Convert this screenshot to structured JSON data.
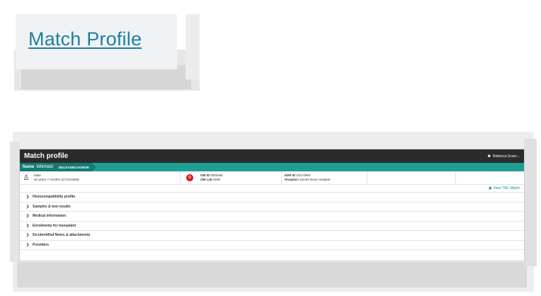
{
  "thumbnail": {
    "link_label": "Match Profile",
    "link_color": "#1e7fa6"
  },
  "app": {
    "title": "Match profile",
    "user_name": "Rebecca Scam...",
    "topbar_color": "#2b2b2b",
    "accent_color": "#1f9e94"
  },
  "donor": {
    "name_label": "Name",
    "name_value": "Withheld",
    "badge": "DECEASED DONOR",
    "sex": "Male",
    "age": "50 years 7 months (27/12/1965)",
    "blood_group": "O",
    "om_id_label": "OM ID",
    "om_id": "0092066",
    "om_lab_label": "OM Lab",
    "om_lab": "NSW",
    "edr_id_label": "EDR ID",
    "edr_id": "D22-0960",
    "hospital_label": "Hospital",
    "hospital": "Lismore Base Hospital"
  },
  "actions": {
    "view_twl_match": "View TWL Match"
  },
  "sections": [
    {
      "label": "Histocompatibility profile"
    },
    {
      "label": "Samples & test results"
    },
    {
      "label": "Medical information"
    },
    {
      "label": "Enrolments for transplant"
    },
    {
      "label": "De-identified Notes & attachments"
    },
    {
      "label": "Providers"
    }
  ],
  "icons": {
    "person": "person-icon",
    "blood": "blood-drop-icon",
    "user": "user-icon",
    "chevron": "chevron-right-icon",
    "twl": "document-icon"
  }
}
